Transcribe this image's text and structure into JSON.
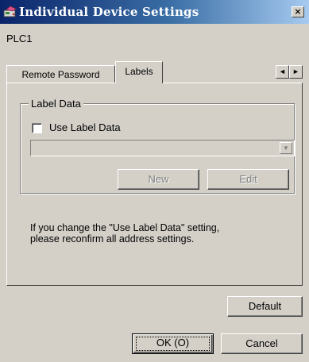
{
  "window": {
    "title": "Individual Device Settings",
    "close_label": "×"
  },
  "device_name": "PLC1",
  "tabs": [
    {
      "label": "Remote Password",
      "active": false
    },
    {
      "label": "Labels",
      "active": true
    }
  ],
  "tab_scroll": {
    "left": "◄",
    "right": "►"
  },
  "label_data": {
    "group_label": "Label Data",
    "checkbox_label": "Use Label Data",
    "checked": false,
    "combo_value": "",
    "combo_arrow": "▼",
    "new_label": "New",
    "edit_label": "Edit"
  },
  "info_text": "If you change the \"Use Label Data\" setting,\nplease reconfirm all address settings.",
  "buttons": {
    "default_label": "Default",
    "ok_label": "OK (O)",
    "cancel_label": "Cancel"
  },
  "icons": {
    "title_icon": "device-settings-icon"
  },
  "colors": {
    "titlebar_start": "#0a246a",
    "titlebar_end": "#a6caf0",
    "face": "#d4d0c8"
  }
}
